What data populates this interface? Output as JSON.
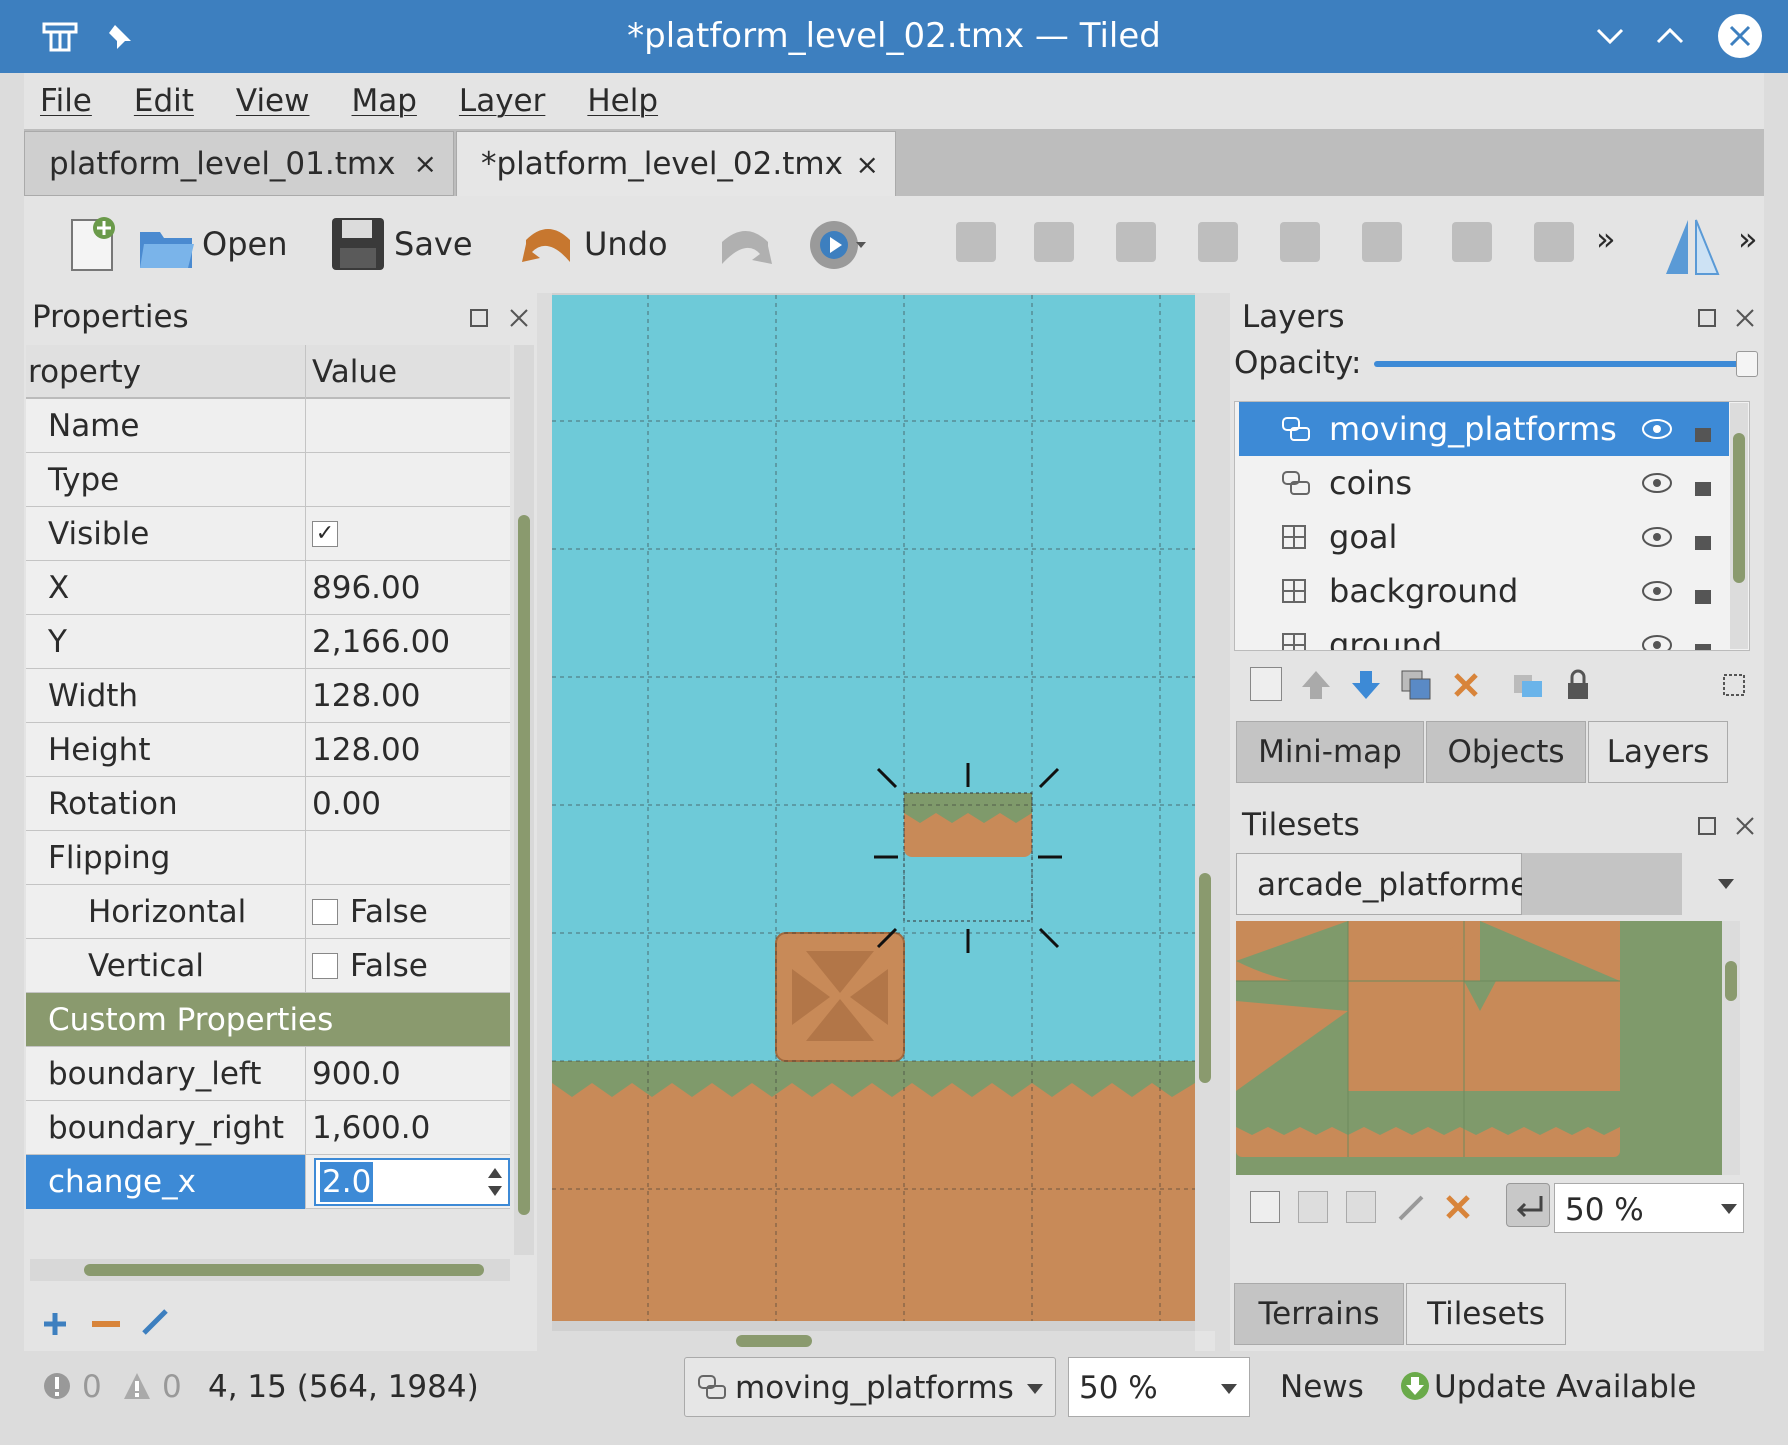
{
  "window": {
    "title": "*platform_level_02.tmx — Tiled"
  },
  "menu": [
    "File",
    "Edit",
    "View",
    "Map",
    "Layer",
    "Help"
  ],
  "doc_tabs": [
    {
      "label": "platform_level_01.tmx",
      "close": "×"
    },
    {
      "label": "*platform_level_02.tmx",
      "close": "×"
    }
  ],
  "toolbar": {
    "open_label": "Open",
    "save_label": "Save",
    "undo_label": "Undo",
    "overflow": "»"
  },
  "properties": {
    "title": "Properties",
    "col_property": "roperty",
    "col_value": "Value",
    "rows": [
      {
        "key": "Name",
        "value": ""
      },
      {
        "key": "Type",
        "value": ""
      },
      {
        "key": "Visible",
        "value": "✓"
      },
      {
        "key": "X",
        "value": "896.00"
      },
      {
        "key": "Y",
        "value": "2,166.00"
      },
      {
        "key": "Width",
        "value": "128.00"
      },
      {
        "key": "Height",
        "value": "128.00"
      },
      {
        "key": "Rotation",
        "value": "0.00"
      },
      {
        "key": "Flipping",
        "value": ""
      },
      {
        "key": "Horizontal",
        "value": "False"
      },
      {
        "key": "Vertical",
        "value": "False"
      }
    ],
    "custom_section": "Custom Properties",
    "custom_rows": [
      {
        "key": "boundary_left",
        "value": "900.0"
      },
      {
        "key": "boundary_right",
        "value": "1,600.0"
      },
      {
        "key": "change_x",
        "value": "2.0"
      }
    ]
  },
  "layers": {
    "title": "Layers",
    "opacity_label": "Opacity:",
    "opacity": 1.0,
    "items": [
      {
        "name": "moving_platforms",
        "type": "object-layer-icon",
        "selected": true
      },
      {
        "name": "coins",
        "type": "object-layer-icon"
      },
      {
        "name": "goal",
        "type": "tile-layer-icon"
      },
      {
        "name": "background",
        "type": "tile-layer-icon"
      },
      {
        "name": "ground",
        "type": "tile-layer-icon"
      }
    ],
    "tabs": [
      "Mini-map",
      "Objects",
      "Layers"
    ]
  },
  "tilesets": {
    "title": "Tilesets",
    "current": "arcade_platformer",
    "zoom": "50 %",
    "tabs": [
      "Terrains",
      "Tilesets"
    ]
  },
  "status": {
    "errors": "0",
    "warnings": "0",
    "coords": "4, 15 (564, 1984)",
    "current_layer": "moving_platforms",
    "zoom": "50 %",
    "news": "News",
    "update": "Update Available"
  },
  "colors": {
    "accent": "#3d8ad6",
    "sky": "#6ecad8",
    "ground": "#c88a58",
    "grass": "#7f9a6b"
  }
}
